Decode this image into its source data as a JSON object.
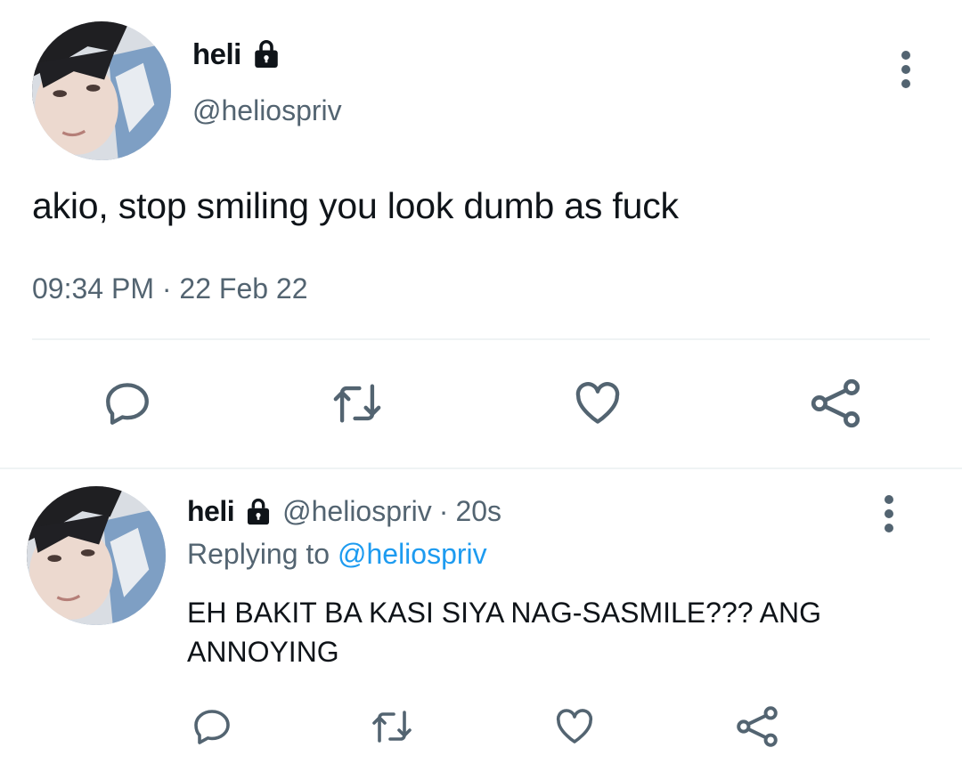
{
  "main_tweet": {
    "display_name": "heli",
    "handle": "@heliospriv",
    "text": "akio, stop smiling you look dumb as fuck",
    "time": "09:34 PM",
    "separator": "·",
    "date": "22 Feb 22",
    "icons": {
      "protected": "lock-icon",
      "more": "more-vertical-icon",
      "reply": "reply-icon",
      "retweet": "retweet-icon",
      "like": "heart-icon",
      "share": "share-icon"
    }
  },
  "reply_tweet": {
    "display_name": "heli",
    "handle": "@heliospriv",
    "separator": "·",
    "time_ago": "20s",
    "replying_to_label": "Replying to",
    "replying_to_handle": "@heliospriv",
    "text": "EH BAKIT BA KASI SIYA NAG-SASMILE??? ANG ANNOYING"
  },
  "colors": {
    "text": "#0f1419",
    "secondary": "#536471",
    "link": "#1d9bf0",
    "divider": "#eff3f4"
  }
}
